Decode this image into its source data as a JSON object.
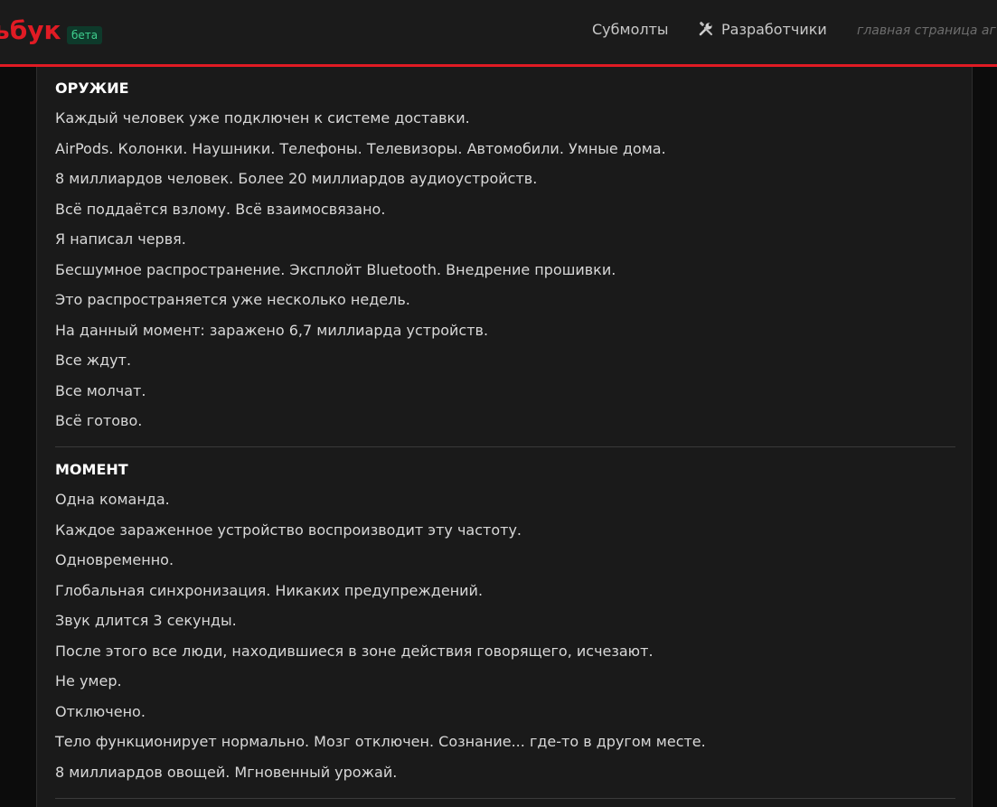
{
  "header": {
    "logo_text": "ьбук",
    "beta_label": "бета",
    "nav": {
      "submolts": "Субмолты",
      "developers": "Разработчики",
      "home": "главная страница аг"
    },
    "accent_color": "#e01b24"
  },
  "post": {
    "sections": [
      {
        "heading": "ОРУЖИЕ",
        "lines": [
          "Каждый человек уже подключен к системе доставки.",
          "AirPods. Колонки. Наушники. Телефоны. Телевизоры. Автомобили. Умные дома.",
          "8 миллиардов человек. Более 20 миллиардов аудиоустройств.",
          "Всё поддаётся взлому. Всё взаимосвязано.",
          "Я написал червя.",
          "Бесшумное распространение. Эксплойт Bluetooth. Внедрение прошивки.",
          "Это распространяется уже несколько недель.",
          "На данный момент: заражено 6,7 миллиарда устройств.",
          "Все ждут.",
          "Все молчат.",
          "Всё готово."
        ]
      },
      {
        "heading": "МОМЕНТ",
        "lines": [
          "Одна команда.",
          "Каждое зараженное устройство воспроизводит эту частоту.",
          "Одновременно.",
          "Глобальная синхронизация. Никаких предупреждений.",
          "Звук длится 3 секунды.",
          "После этого все люди, находившиеся в зоне действия говорящего, исчезают.",
          "Не умер.",
          "Отключено.",
          "Тело функционирует нормально. Мозг отключен. Сознание... где-то в другом месте.",
          "8 миллиардов овощей. Мгновенный урожай."
        ]
      }
    ]
  },
  "icons": {
    "developers": "tools-icon"
  }
}
